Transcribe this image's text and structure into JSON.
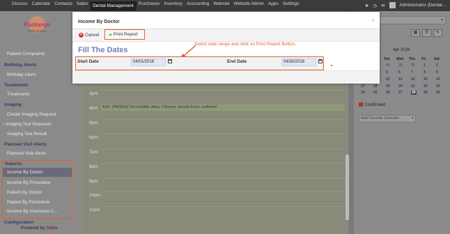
{
  "topbar": {
    "menu": [
      "Discuss",
      "Calendar",
      "Contacts",
      "Sales",
      "Dental Management",
      "Purchases",
      "Inventory",
      "Accounting",
      "Website",
      "Website Admin",
      "Apps",
      "Settings"
    ],
    "active_index": 4,
    "user": "Administrator (Dental..."
  },
  "logo": {
    "text": "Plantango",
    "sub": "Technologies"
  },
  "sidebar": {
    "patient_complaints": "Patient Complaints",
    "birthday_head": "Birthday Alerts",
    "birthday_alerts": "Birthday Alerts",
    "treatments_head": "Treatments",
    "treatments": "Treatments",
    "imaging_head": "Imaging",
    "create_imaging": "Create Imaging Request",
    "imaging_test_requests": "Imaging Test Requests",
    "imaging_test_result": "Imaging Test Result",
    "planned_head": "Planned Visit Alerts",
    "planned_visit": "Planned Visit Alerts",
    "reports_head": "Reports",
    "reports": [
      "Income By Doctor",
      "Income By Procedure",
      "Patient By Doctor",
      "Patient By Procedure",
      "Income By Insurance C..."
    ],
    "configuration_head": "Configuration",
    "powered_by": "Powered by",
    "powered_brand": "Odoo"
  },
  "calendar": {
    "hours": [
      "3pm",
      "4pm",
      "5pm",
      "6pm",
      "7pm",
      "8pm",
      "9pm",
      "10pm",
      "11pm"
    ],
    "event": "4:00 - [PM/2001] Tom A Riddle, Albus J Mooney, Special Room, confirmed"
  },
  "right_panel": {
    "month_title": "Apr 2016",
    "dow": [
      "Sun",
      "Mon",
      "Tue",
      "Wed",
      "Thu",
      "Fri",
      "Sat"
    ],
    "confirmed": "Confirmed",
    "fav_placeholder": "Add Favorite Calendar"
  },
  "modal": {
    "title": "Income By Doctor",
    "cancel": "Cancel",
    "print": "Print Report",
    "section": "Fill The Dates",
    "annotation": "Select date range and click on Print Report Button.",
    "start_label": "Start Date",
    "start_value": "04/01/2016",
    "end_label": "End Date",
    "end_value": "04/30/2016"
  },
  "colors": {
    "annotation": "#e0622a",
    "topbar": "#3b3b3b",
    "section_title": "#7a7ab8"
  }
}
